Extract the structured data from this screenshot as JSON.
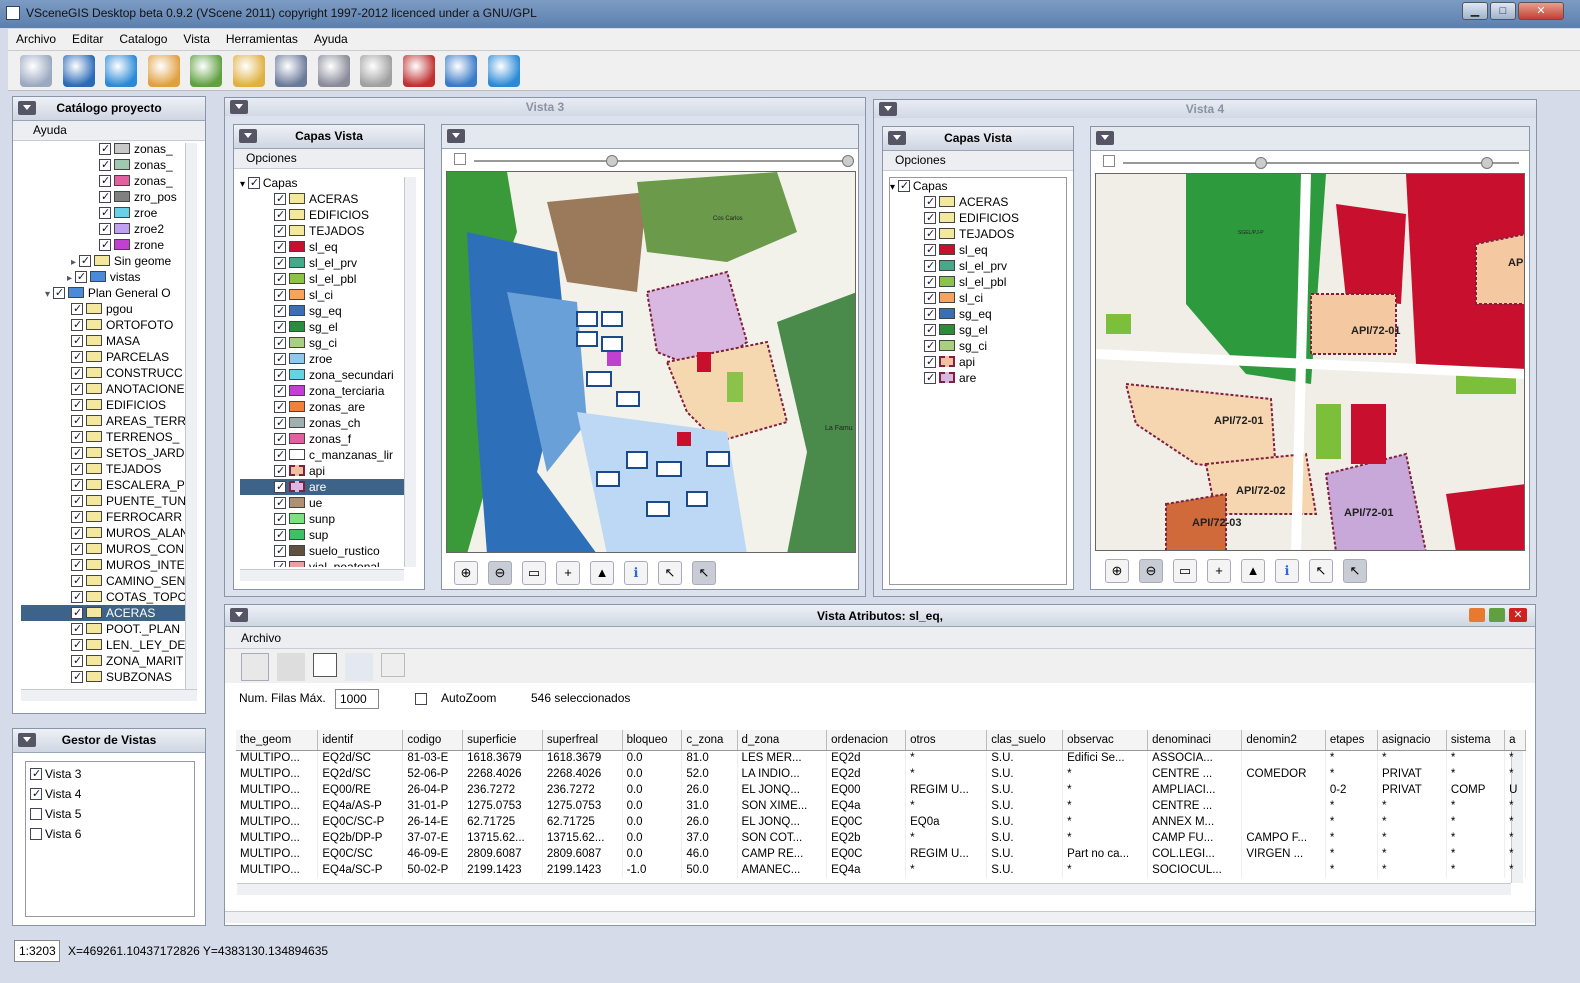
{
  "app": {
    "title": "VSceneGIS Desktop  beta 0.9.2     (VScene 2011) copyright 1997-2012 licenced under a GNU/GPL"
  },
  "menu": [
    "Archivo",
    "Editar",
    "Catalogo",
    "Vista",
    "Herramientas",
    "Ayuda"
  ],
  "toolbar_icons": [
    "connect-icon",
    "network-icon",
    "globe-icon",
    "monitor-icon",
    "new-document-icon",
    "open-folder-icon",
    "save-icon",
    "print-icon",
    "database-icon",
    "tools-icon",
    "back-icon",
    "refresh-icon"
  ],
  "catalog": {
    "title": "Catálogo proyecto",
    "menu": "Ayuda",
    "items": [
      {
        "label": "zonas_",
        "indent": 2
      },
      {
        "label": "zonas_",
        "indent": 2
      },
      {
        "label": "zonas_",
        "indent": 2
      },
      {
        "label": "zro_pos",
        "indent": 2
      },
      {
        "label": "zroe",
        "indent": 2
      },
      {
        "label": "zroe2",
        "indent": 2
      },
      {
        "label": "zrone",
        "indent": 2
      },
      {
        "label": "Sin geome",
        "indent": 1
      },
      {
        "label": "vistas",
        "indent": 0.5
      },
      {
        "label": "Plan General O",
        "indent": 0
      },
      {
        "label": "pgou",
        "indent": 1
      },
      {
        "label": "ORTOFOTO",
        "indent": 1
      },
      {
        "label": "MASA",
        "indent": 1
      },
      {
        "label": "PARCELAS",
        "indent": 1
      },
      {
        "label": "CONSTRUCC",
        "indent": 1
      },
      {
        "label": "ANOTACIONE",
        "indent": 1
      },
      {
        "label": "EDIFICIOS",
        "indent": 1
      },
      {
        "label": "AREAS_TERR",
        "indent": 1
      },
      {
        "label": "TERRENOS_",
        "indent": 1
      },
      {
        "label": "SETOS_JARD",
        "indent": 1
      },
      {
        "label": "TEJADOS",
        "indent": 1
      },
      {
        "label": "ESCALERA_P",
        "indent": 1
      },
      {
        "label": "PUENTE_TUN",
        "indent": 1
      },
      {
        "label": "FERROCARR",
        "indent": 1
      },
      {
        "label": "MUROS_ALAN",
        "indent": 1
      },
      {
        "label": "MUROS_CON",
        "indent": 1
      },
      {
        "label": "MUROS_INTE",
        "indent": 1
      },
      {
        "label": "CAMINO_SEN",
        "indent": 1
      },
      {
        "label": "COTAS_TOPO",
        "indent": 1
      },
      {
        "label": "ACERAS",
        "indent": 1
      },
      {
        "label": "POOT._PLAN",
        "indent": 1
      },
      {
        "label": "LEN._LEY_DE",
        "indent": 1
      },
      {
        "label": "ZONA_MARIT",
        "indent": 1
      },
      {
        "label": "SUBZONAS",
        "indent": 1
      }
    ],
    "selected": "ACERAS"
  },
  "views_manager": {
    "title": "Gestor de Vistas",
    "items": [
      {
        "label": "Vista 3",
        "checked": true
      },
      {
        "label": "Vista 4",
        "checked": true
      },
      {
        "label": "Vista 5",
        "checked": false
      },
      {
        "label": "Vista 6",
        "checked": false
      }
    ]
  },
  "vista3": {
    "title": "Vista 3",
    "layers_title": "Capas Vista",
    "options": "Opciones",
    "root": "Capas",
    "layers": [
      {
        "label": "ACERAS",
        "color": "#f4e8a0"
      },
      {
        "label": "EDIFICIOS",
        "color": "#f4e8a0"
      },
      {
        "label": "TEJADOS",
        "color": "#f4e8a0"
      },
      {
        "label": "sl_eq",
        "color": "#c8102e"
      },
      {
        "label": "sl_el_prv",
        "color": "#4aa88a"
      },
      {
        "label": "sl_el_pbl",
        "color": "#8bc34a"
      },
      {
        "label": "sl_ci",
        "color": "#f4a460"
      },
      {
        "label": "sg_eq",
        "color": "#3a6fb0"
      },
      {
        "label": "sg_el",
        "color": "#2e8b3a"
      },
      {
        "label": "sg_ci",
        "color": "#a8d080"
      },
      {
        "label": "zroe",
        "color": "#8fc8f0"
      },
      {
        "label": "zona_secundari",
        "color": "#6ad0e8"
      },
      {
        "label": "zona_terciaria",
        "color": "#c040d0"
      },
      {
        "label": "zonas_are",
        "color": "#f08040"
      },
      {
        "label": "zonas_ch",
        "color": "#a0b0b0"
      },
      {
        "label": "zonas_f",
        "color": "#e060a0"
      },
      {
        "label": "c_manzanas_lir",
        "color": "#ffffff"
      },
      {
        "label": "api",
        "color": "#f0c0a0"
      },
      {
        "label": "are",
        "color": "#d8b8e0"
      },
      {
        "label": "ue",
        "color": "#b09070"
      },
      {
        "label": "sunp",
        "color": "#80e080"
      },
      {
        "label": "sup",
        "color": "#40c060"
      },
      {
        "label": "suelo_rustico",
        "color": "#605040"
      },
      {
        "label": "vial_peatonal",
        "color": "#e8a0a0"
      }
    ],
    "selected": "are",
    "map_labels": [
      "Cos Carlos",
      "La Famu"
    ]
  },
  "vista4": {
    "title": "Vista 4",
    "layers_title": "Capas Vista",
    "options": "Opciones",
    "root": "Capas",
    "layers": [
      {
        "label": "ACERAS",
        "color": "#f4e8a0"
      },
      {
        "label": "EDIFICIOS",
        "color": "#f4e8a0"
      },
      {
        "label": "TEJADOS",
        "color": "#f4e8a0"
      },
      {
        "label": "sl_eq",
        "color": "#c8102e"
      },
      {
        "label": "sl_el_prv",
        "color": "#4aa88a"
      },
      {
        "label": "sl_el_pbl",
        "color": "#8bc34a"
      },
      {
        "label": "sl_ci",
        "color": "#f4a460"
      },
      {
        "label": "sg_eq",
        "color": "#3a6fb0"
      },
      {
        "label": "sg_el",
        "color": "#2e8b3a"
      },
      {
        "label": "sg_ci",
        "color": "#a8d080"
      },
      {
        "label": "api",
        "color": "#f0c0a0"
      },
      {
        "label": "are",
        "color": "#d8b8e0"
      }
    ],
    "map_labels": [
      "API/72-01",
      "API/72-01",
      "API/72-02",
      "API/72-03",
      "API/72-01",
      "AP",
      "SGEL/PJ-P"
    ]
  },
  "attributes": {
    "title": "Vista Atributos: sl_eq,",
    "menu": "Archivo",
    "max_rows_label": "Num. Filas Máx.",
    "max_rows_value": "1000",
    "autozoom_label": "AutoZoom",
    "selected_count": "546 seleccionados",
    "columns": [
      "the_geom",
      "identif",
      "codigo",
      "superficie",
      "superfreal",
      "bloqueo",
      "c_zona",
      "d_zona",
      "ordenacion",
      "otros",
      "clas_suelo",
      "observac",
      "denominaci",
      "denomin2",
      "etapes",
      "asignacio",
      "sistema",
      "a"
    ],
    "rows": [
      [
        "MULTIPO...",
        "EQ2d/SC",
        "81-03-E",
        "1618.3679",
        "1618.3679",
        "0.0",
        "81.0",
        "LES MER...",
        "EQ2d",
        "*",
        "S.U.",
        "Edifici Se...",
        "ASSOCIA...",
        "",
        "*",
        "*",
        "*",
        "*"
      ],
      [
        "MULTIPO...",
        "EQ2d/SC",
        "52-06-P",
        "2268.4026",
        "2268.4026",
        "0.0",
        "52.0",
        "LA INDIO...",
        "EQ2d",
        "*",
        "S.U.",
        "*",
        "CENTRE ...",
        "COMEDOR",
        "*",
        "PRIVAT",
        "*",
        "*"
      ],
      [
        "MULTIPO...",
        "EQ00/RE",
        "26-04-P",
        "236.7272",
        "236.7272",
        "0.0",
        "26.0",
        "EL JONQ...",
        "EQ00",
        "REGIM U...",
        "S.U.",
        "*",
        "AMPLIACI...",
        "",
        "0-2",
        "PRIVAT",
        "COMP",
        "U"
      ],
      [
        "MULTIPO...",
        "EQ4a/AS-P",
        "31-01-P",
        "1275.0753",
        "1275.0753",
        "0.0",
        "31.0",
        "SON XIME...",
        "EQ4a",
        "*",
        "S.U.",
        "*",
        "CENTRE ...",
        "",
        "*",
        "*",
        "*",
        "*"
      ],
      [
        "MULTIPO...",
        "EQ0C/SC-P",
        "26-14-E",
        "62.71725",
        "62.71725",
        "0.0",
        "26.0",
        "EL JONQ...",
        "EQ0C",
        "EQ0a",
        "S.U.",
        "*",
        "ANNEX M...",
        "",
        "*",
        "*",
        "*",
        "*"
      ],
      [
        "MULTIPO...",
        "EQ2b/DP-P",
        "37-07-E",
        "13715.62...",
        "13715.62...",
        "0.0",
        "37.0",
        "SON COT...",
        "EQ2b",
        "*",
        "S.U.",
        "*",
        "CAMP FU...",
        "CAMPO F...",
        "*",
        "*",
        "*",
        "*"
      ],
      [
        "MULTIPO...",
        "EQ0C/SC",
        "46-09-E",
        "2809.6087",
        "2809.6087",
        "0.0",
        "46.0",
        "CAMP RE...",
        "EQ0C",
        "REGIM U...",
        "S.U.",
        "Part no ca...",
        "COL.LEGI...",
        "VIRGEN ...",
        "*",
        "*",
        "*",
        "*"
      ],
      [
        "MULTIPO...",
        "EQ4a/SC-P",
        "50-02-P",
        "2199.1423",
        "2199.1423",
        "-1.0",
        "50.0",
        "AMANEC...",
        "EQ4a",
        "*",
        "S.U.",
        "*",
        "SOCIOCUL...",
        "",
        "*",
        "*",
        "*",
        "*"
      ]
    ]
  },
  "status": {
    "scale": "1:3203",
    "coords": "X=469261.10437172826  Y=4383130.134894635"
  }
}
